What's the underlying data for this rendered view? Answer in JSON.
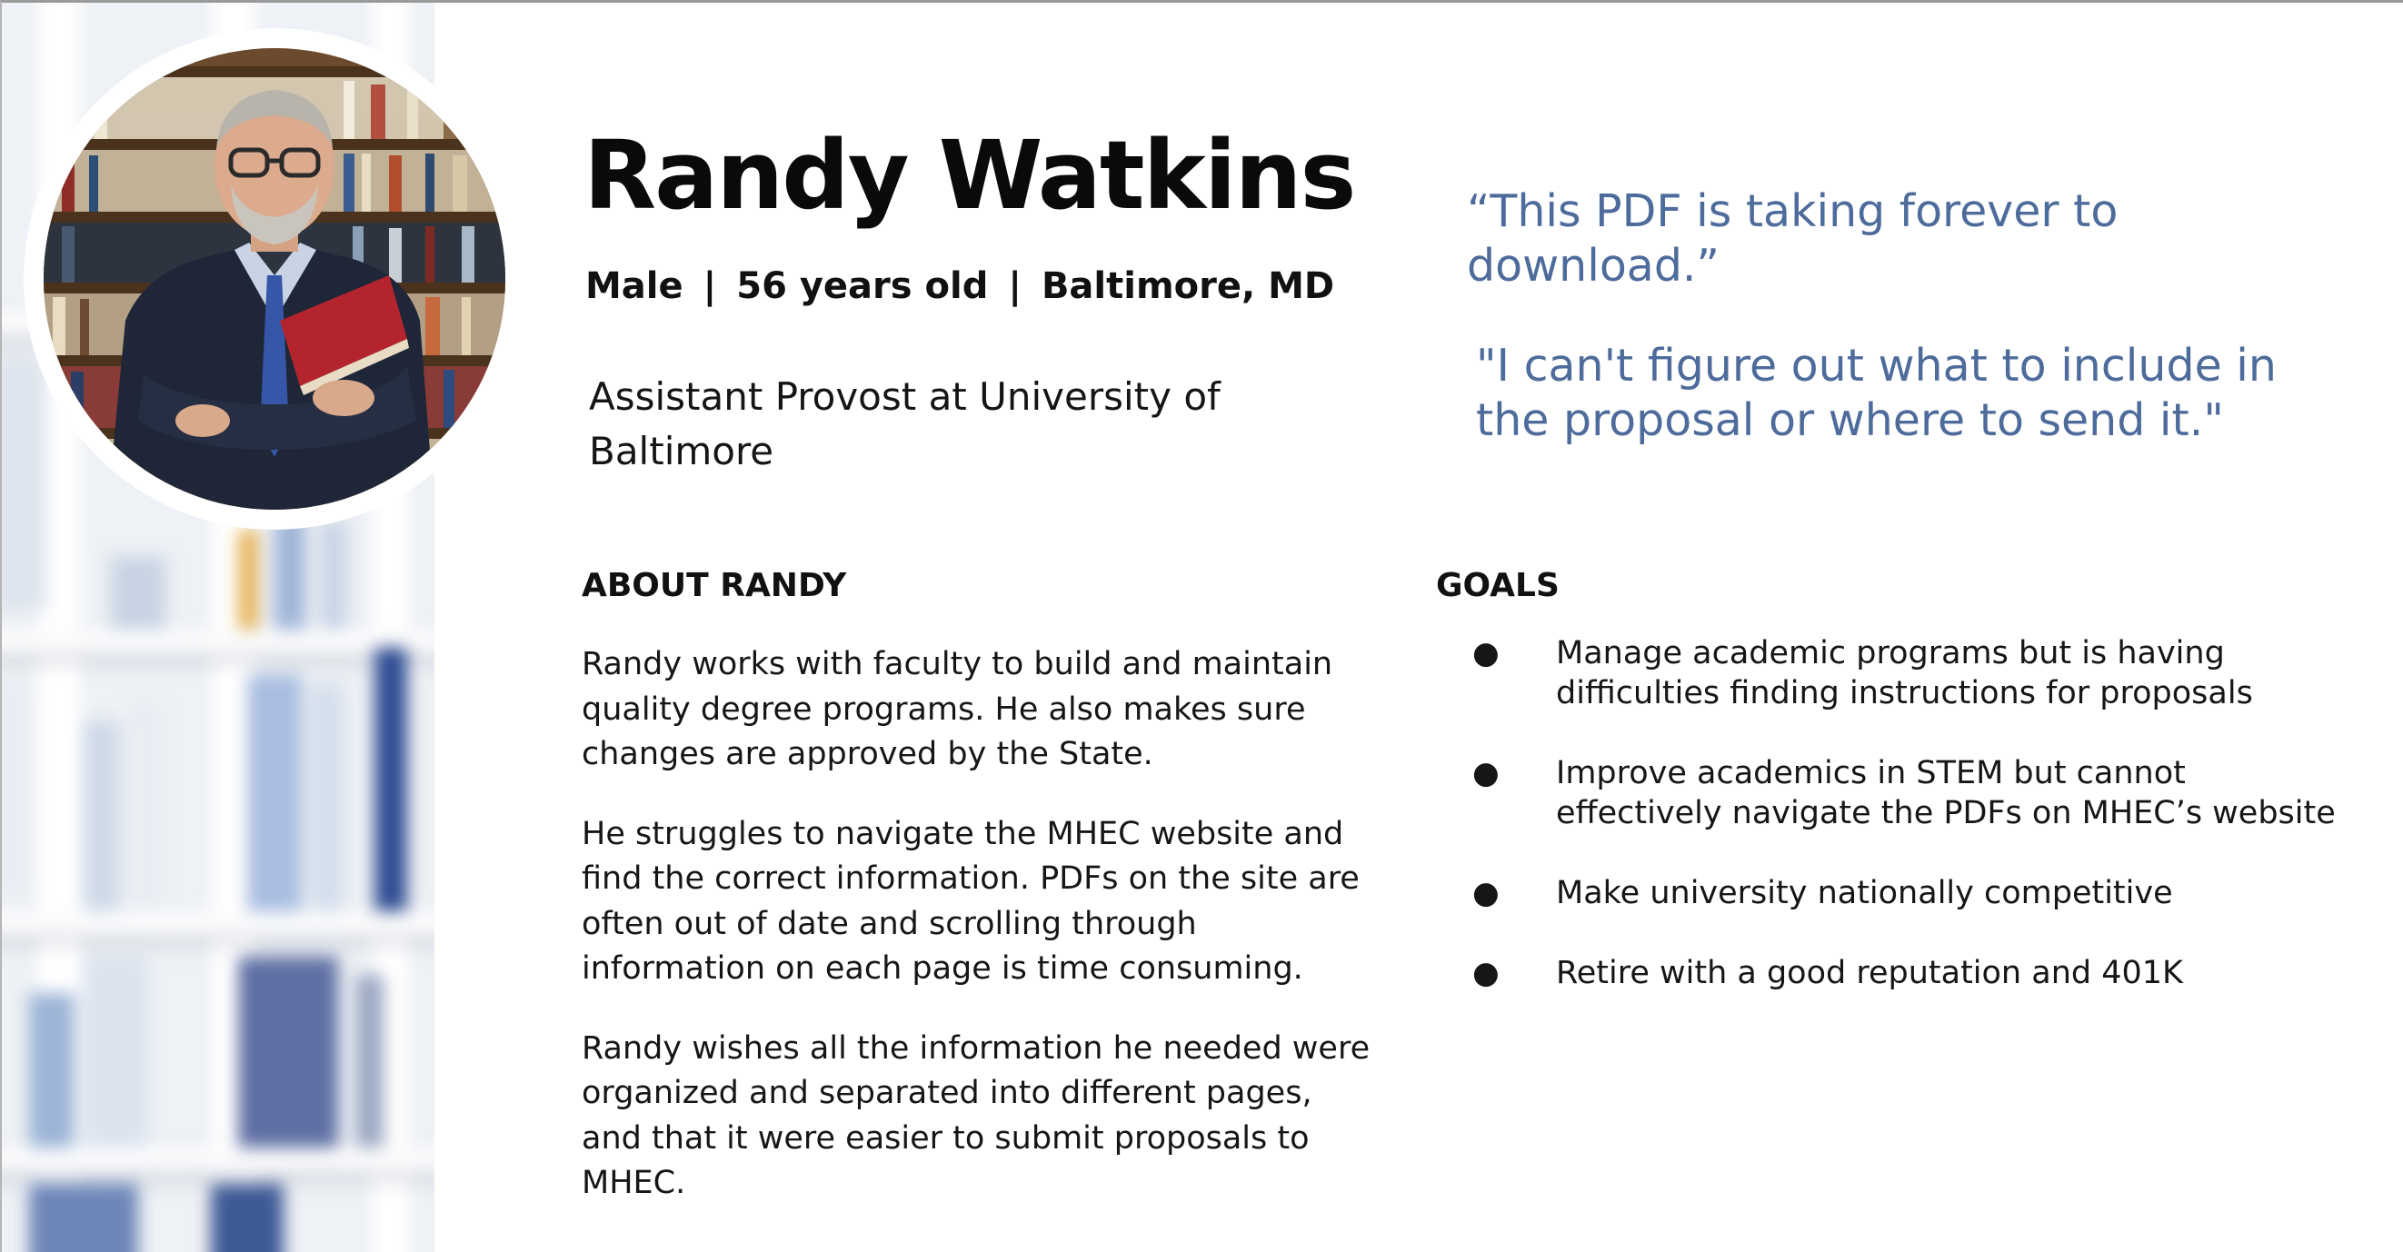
{
  "persona": {
    "name": "Randy Watkins",
    "gender": "Male",
    "age": "56 years old",
    "location": "Baltimore, MD",
    "separator": "|",
    "job_title": "Assistant Provost at University of Baltimore"
  },
  "quotes": [
    "“This PDF is taking forever to download.”",
    "\"I can't figure out what to include in the proposal or where to send it.\""
  ],
  "about": {
    "title": "ABOUT RANDY",
    "paragraphs": [
      "Randy works with faculty to build and maintain quality degree programs. He also makes sure changes are approved by the State.",
      "He struggles to navigate the MHEC website and find the correct information. PDFs on the site are often out of date and scrolling through information on each page is time consuming.",
      "Randy wishes all the information he needed were organized and separated into different pages, and that it were easier to submit proposals to MHEC."
    ]
  },
  "goals": {
    "title": "GOALS",
    "bullet": "●",
    "items": [
      "Manage academic programs but is having difficulties finding instructions for proposals",
      "Improve academics in STEM but cannot effectively navigate the PDFs on MHEC’s website",
      "Make university nationally competitive",
      "Retire with a good reputation and 401K"
    ]
  },
  "colors": {
    "quote": "#4d6b9b",
    "text": "#111111",
    "background": "#ffffff"
  },
  "icons": {
    "bullet": "bullet-dot-icon"
  }
}
